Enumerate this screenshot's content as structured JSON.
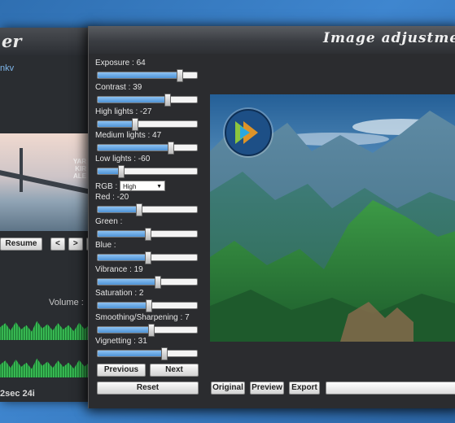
{
  "background_window": {
    "title_fragment": "er",
    "link_fragment": "nkv",
    "photo_words": "YAR\nKIR\nALE",
    "buttons": [
      "Resume",
      "<",
      ">",
      ""
    ],
    "volume_label": "Volume :",
    "time_text": "2sec 24i"
  },
  "main_window": {
    "title": "Image adjustme",
    "controls": [
      {
        "label": "Exposure : 64",
        "value": 0.82
      },
      {
        "label": "Contrast : 39",
        "value": 0.7
      },
      {
        "label": "High lights : -27",
        "value": 0.37
      },
      {
        "label": "Medium lights : 47",
        "value": 0.73
      },
      {
        "label": "Low lights : -60",
        "value": 0.23
      },
      {
        "label": "Red : -20",
        "value": 0.41
      },
      {
        "label": "Green :",
        "value": 0.5
      },
      {
        "label": "Blue :",
        "value": 0.5
      },
      {
        "label": "Vibrance : 19",
        "value": 0.6
      },
      {
        "label": "Saturation : 2",
        "value": 0.51
      },
      {
        "label": "Smoothing/Sharpening : 7",
        "value": 0.53
      },
      {
        "label": "Vignetting : 31",
        "value": 0.66
      }
    ],
    "rgb": {
      "label": "RGB :",
      "selected": "High"
    },
    "buttons": {
      "previous": "Previous",
      "next": "Next",
      "reset": "Reset",
      "original": "Original",
      "preview": "Preview",
      "export": "Export"
    }
  },
  "colors": {
    "slider_fill": "#5aa0e0",
    "window_bg": "#2b2c2f",
    "desktop": "#3a7fc4"
  }
}
